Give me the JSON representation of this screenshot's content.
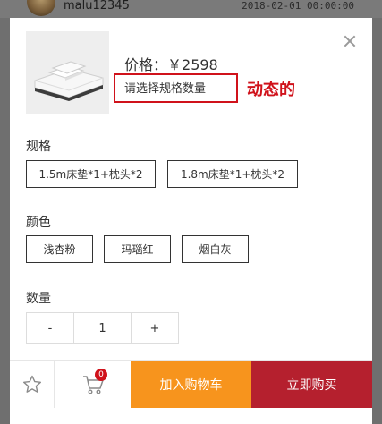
{
  "background": {
    "username": "malu12345",
    "timestamp": "2018-02-01 00:00:00"
  },
  "product": {
    "price_label": "价格：",
    "price_value": "￥2598",
    "spec_hint": "请选择规格数量",
    "annotation": "动态的"
  },
  "spec": {
    "title": "规格",
    "options": [
      "1.5m床垫*1+枕头*2",
      "1.8m床垫*1+枕头*2"
    ]
  },
  "color": {
    "title": "颜色",
    "options": [
      "浅杏粉",
      "玛瑙红",
      "烟白灰"
    ]
  },
  "quantity": {
    "title": "数量",
    "minus": "-",
    "value": "1",
    "plus": "+"
  },
  "bottom_bar": {
    "cart_count": "0",
    "add_to_cart": "加入购物车",
    "buy_now": "立即购买"
  },
  "colors": {
    "accent_orange": "#f7941d",
    "accent_red": "#b5202e",
    "annotation_red": "#d0121b"
  },
  "icons": [
    "star-icon",
    "cart-icon",
    "close-icon"
  ]
}
